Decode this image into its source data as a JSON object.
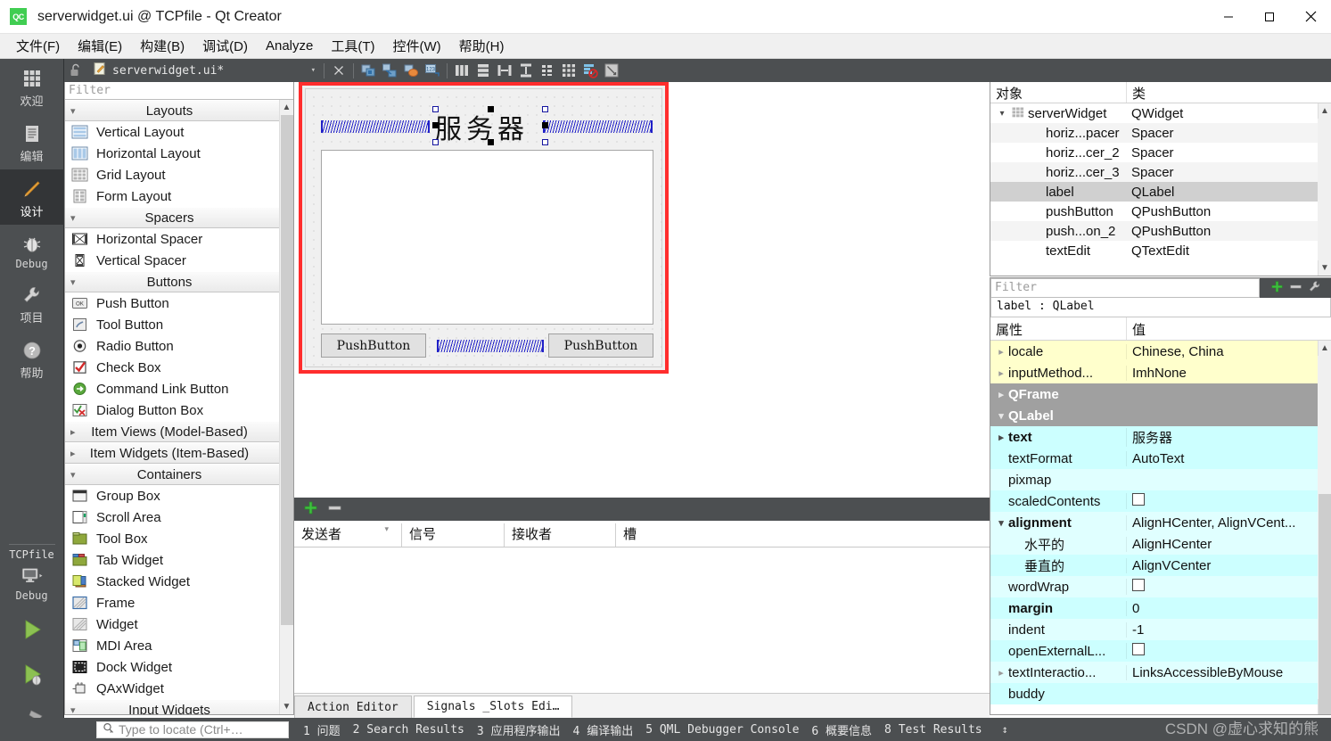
{
  "window": {
    "title": "serverwidget.ui @ TCPfile - Qt Creator",
    "logo_text": "QC",
    "minimize": "—",
    "maximize": "☐",
    "close": "✕"
  },
  "menubar": {
    "items": [
      {
        "label": "文件(F)",
        "mnemonic": "F"
      },
      {
        "label": "编辑(E)",
        "mnemonic": "E"
      },
      {
        "label": "构建(B)",
        "mnemonic": "B"
      },
      {
        "label": "调试(D)",
        "mnemonic": "D"
      },
      {
        "label": "Analyze",
        "mnemonic": "A"
      },
      {
        "label": "工具(T)",
        "mnemonic": "T"
      },
      {
        "label": "控件(W)",
        "mnemonic": "W"
      },
      {
        "label": "帮助(H)",
        "mnemonic": "H"
      }
    ]
  },
  "modebar": {
    "modes": [
      {
        "label": "欢迎",
        "icon": "grid-icon",
        "active": false
      },
      {
        "label": "编辑",
        "icon": "document-icon",
        "active": false
      },
      {
        "label": "设计",
        "icon": "pencil-icon",
        "active": true
      },
      {
        "label": "Debug",
        "icon": "bug-icon",
        "active": false
      },
      {
        "label": "项目",
        "icon": "wrench-icon",
        "active": false
      },
      {
        "label": "帮助",
        "icon": "question-icon",
        "active": false
      }
    ],
    "kit_name": "TCPfile",
    "kit_build": "Debug",
    "run_buttons": [
      "run-icon",
      "debug-icon",
      "build-icon"
    ]
  },
  "editor_toolbar": {
    "document_name": "serverwidget.ui*",
    "lock_icon": "unlocked-icon",
    "file_icon": "ui-file-icon",
    "dropdown_caret": "▾",
    "buttons": [
      "close-document-icon",
      "edit-widgets-icon",
      "edit-signals-slots-icon",
      "edit-buddies-icon",
      "edit-tab-order-icon",
      "layout-horizontal-icon",
      "layout-vertical-icon",
      "layout-splitter-horizontal-icon",
      "layout-splitter-vertical-icon",
      "layout-form-icon",
      "layout-grid-icon",
      "adjust-size-icon",
      "break-layout-icon",
      "preview-icon"
    ]
  },
  "widget_box": {
    "filter_placeholder": "Filter",
    "sections": [
      {
        "title": "Layouts",
        "expanded": true,
        "items": [
          {
            "label": "Vertical Layout",
            "icon": "vertical-layout-icon"
          },
          {
            "label": "Horizontal Layout",
            "icon": "horizontal-layout-icon"
          },
          {
            "label": "Grid Layout",
            "icon": "grid-layout-icon"
          },
          {
            "label": "Form Layout",
            "icon": "form-layout-icon"
          }
        ]
      },
      {
        "title": "Spacers",
        "expanded": true,
        "items": [
          {
            "label": "Horizontal Spacer",
            "icon": "horizontal-spacer-icon"
          },
          {
            "label": "Vertical Spacer",
            "icon": "vertical-spacer-icon"
          }
        ]
      },
      {
        "title": "Buttons",
        "expanded": true,
        "items": [
          {
            "label": "Push Button",
            "icon": "push-button-icon"
          },
          {
            "label": "Tool Button",
            "icon": "tool-button-icon"
          },
          {
            "label": "Radio Button",
            "icon": "radio-button-icon"
          },
          {
            "label": "Check Box",
            "icon": "check-box-icon"
          },
          {
            "label": "Command Link Button",
            "icon": "command-link-button-icon"
          },
          {
            "label": "Dialog Button Box",
            "icon": "dialog-button-box-icon"
          }
        ]
      },
      {
        "title": "Item Views (Model-Based)",
        "expanded": false,
        "items": []
      },
      {
        "title": "Item Widgets (Item-Based)",
        "expanded": false,
        "items": []
      },
      {
        "title": "Containers",
        "expanded": true,
        "items": [
          {
            "label": "Group Box",
            "icon": "group-box-icon"
          },
          {
            "label": "Scroll Area",
            "icon": "scroll-area-icon"
          },
          {
            "label": "Tool Box",
            "icon": "tool-box-icon"
          },
          {
            "label": "Tab Widget",
            "icon": "tab-widget-icon"
          },
          {
            "label": "Stacked Widget",
            "icon": "stacked-widget-icon"
          },
          {
            "label": "Frame",
            "icon": "frame-icon"
          },
          {
            "label": "Widget",
            "icon": "widget-icon"
          },
          {
            "label": "MDI Area",
            "icon": "mdi-area-icon"
          },
          {
            "label": "Dock Widget",
            "icon": "dock-widget-icon"
          },
          {
            "label": "QAxWidget",
            "icon": "qax-widget-icon"
          }
        ]
      },
      {
        "title": "Input Widgets",
        "expanded": true,
        "items": []
      }
    ]
  },
  "form": {
    "label_text": "服务器",
    "button_left": "PushButton",
    "button_right": "PushButton",
    "selected_widget": "label"
  },
  "object_inspector": {
    "columns": [
      "对象",
      "类"
    ],
    "rows": [
      {
        "name": "serverWidget",
        "class": "QWidget",
        "level": 0,
        "expanded": true,
        "selected": false,
        "icon": "widget-icon"
      },
      {
        "name": "horiz...pacer",
        "class": "Spacer",
        "level": 1,
        "selected": false
      },
      {
        "name": "horiz...cer_2",
        "class": "Spacer",
        "level": 1,
        "selected": false
      },
      {
        "name": "horiz...cer_3",
        "class": "Spacer",
        "level": 1,
        "selected": false
      },
      {
        "name": "label",
        "class": "QLabel",
        "level": 1,
        "selected": true
      },
      {
        "name": "pushButton",
        "class": "QPushButton",
        "level": 1,
        "selected": false
      },
      {
        "name": "push...on_2",
        "class": "QPushButton",
        "level": 1,
        "selected": false
      },
      {
        "name": "textEdit",
        "class": "QTextEdit",
        "level": 1,
        "selected": false
      }
    ]
  },
  "property_editor": {
    "filter_placeholder": "Filter",
    "object_header": "label : QLabel",
    "columns": [
      "属性",
      "值"
    ],
    "tool_buttons": [
      "add-property-icon",
      "remove-property-icon",
      "configure-icon"
    ],
    "rows": [
      {
        "name": "locale",
        "value": "Chinese, China",
        "style": "yellow",
        "arrow": true
      },
      {
        "name": "inputMethod...",
        "value": "ImhNone",
        "style": "yellow",
        "arrow": true
      },
      {
        "name": "QFrame",
        "value": "",
        "style": "group",
        "arrow": true,
        "collapsed": true
      },
      {
        "name": "QLabel",
        "value": "",
        "style": "group",
        "arrow": true,
        "collapsed": false
      },
      {
        "name": "text",
        "value": "服务器",
        "style": "cyan",
        "arrow": true,
        "bold": true
      },
      {
        "name": "textFormat",
        "value": "AutoText",
        "style": "cyan"
      },
      {
        "name": "pixmap",
        "value": "",
        "style": "cyan2"
      },
      {
        "name": "scaledContents",
        "value": "",
        "style": "cyan",
        "checkbox": true
      },
      {
        "name": "alignment",
        "value": "AlignHCenter, AlignVCent...",
        "style": "cyan2",
        "arrow": true,
        "bold": true,
        "collapsed": false
      },
      {
        "name": "水平的",
        "value": "AlignHCenter",
        "style": "cyan2",
        "indent": true
      },
      {
        "name": "垂直的",
        "value": "AlignVCenter",
        "style": "cyan",
        "indent": true
      },
      {
        "name": "wordWrap",
        "value": "",
        "style": "cyan2",
        "checkbox": true
      },
      {
        "name": "margin",
        "value": "0",
        "style": "cyan",
        "bold": true
      },
      {
        "name": "indent",
        "value": "-1",
        "style": "cyan2"
      },
      {
        "name": "openExternalL...",
        "value": "",
        "style": "cyan",
        "checkbox": true
      },
      {
        "name": "textInteractio...",
        "value": "LinksAccessibleByMouse",
        "style": "cyan2",
        "arrow": true
      },
      {
        "name": "buddy",
        "value": "",
        "style": "cyan"
      }
    ]
  },
  "signals_slots": {
    "columns": [
      "发送者",
      "信号",
      "接收者",
      "槽"
    ],
    "add_icon": "plus-icon",
    "remove_icon": "minus-icon",
    "rows": []
  },
  "bottom_tabs": [
    {
      "label": "Action Editor",
      "active": false
    },
    {
      "label": "Signals _Slots Edi…",
      "active": true
    }
  ],
  "statusbar": {
    "locator_placeholder": "Type to locate (Ctrl+…",
    "locator_icon": "search-icon",
    "output_tabs": [
      "1 问题",
      "2 Search Results",
      "3 应用程序输出",
      "4 编译输出",
      "5 QML Debugger Console",
      "6 概要信息",
      "8 Test Results"
    ],
    "updown_icon": "↕"
  },
  "watermark": "CSDN @虚心求知的熊",
  "colors": {
    "accent_green": "#41cd52",
    "dark_chrome": "#4c4f51",
    "selection_red": "#ff2d2d",
    "prop_yellow": "#ffffcc",
    "prop_cyan": "#ccffff",
    "prop_group": "#a0a0a0"
  }
}
